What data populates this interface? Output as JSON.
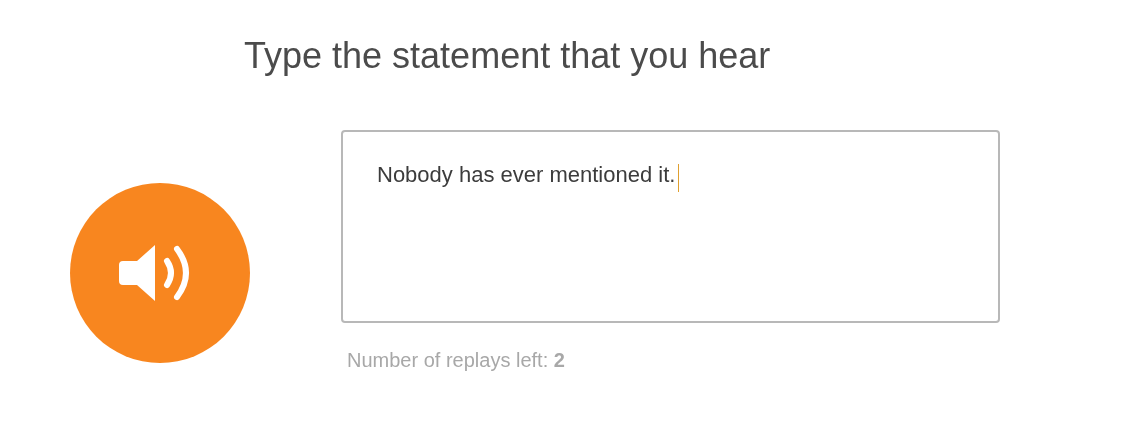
{
  "title": "Type the statement that you hear",
  "answer": {
    "value": "Nobody has ever mentioned it."
  },
  "replays": "Number of replays left: **2**"
}
